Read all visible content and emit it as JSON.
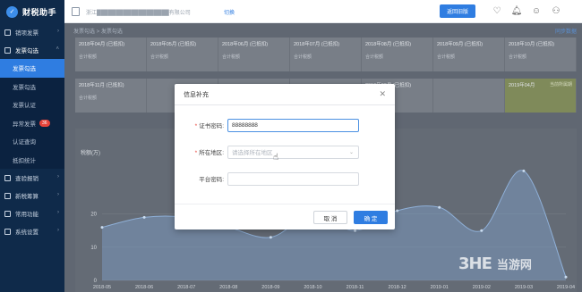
{
  "app": {
    "title": "财税助手",
    "company_name": "浙江███████████████████有限公司",
    "switch_label": "切换",
    "return_label": "返回旧版"
  },
  "top_icons": [
    "heart-icon",
    "bell-icon",
    "chat-icon",
    "user-icon"
  ],
  "sidebar": {
    "groups": [
      {
        "label": "销项发票",
        "open": false
      },
      {
        "label": "发票勾选",
        "open": true
      }
    ],
    "sub_items": [
      {
        "label": "发票勾选",
        "active": true
      },
      {
        "label": "发票勾选",
        "active": false
      },
      {
        "label": "发票认证",
        "active": false
      },
      {
        "label": "异常发票",
        "active": false,
        "badge": "36"
      },
      {
        "label": "认证查询",
        "active": false
      },
      {
        "label": "抵扣统计",
        "active": false
      }
    ],
    "more_groups": [
      {
        "label": "查验报销"
      },
      {
        "label": "新税筹算"
      },
      {
        "label": "常用功能"
      },
      {
        "label": "系统设置"
      }
    ]
  },
  "main": {
    "breadcrumb": "发票勾选 > 发票勾选",
    "sync_label": "同步数据",
    "months_row1": [
      "2018年04月 (已抵扣)",
      "2018年05月 (已抵扣)",
      "2018年06月 (已抵扣)",
      "2018年07月 (已抵扣)",
      "2018年08月 (已抵扣)",
      "2018年09月 (已抵扣)",
      "2018年10月 (已抵扣)"
    ],
    "months_row2": [
      "2018年11月 (已抵扣)",
      "",
      "",
      "",
      "2019年03月 (已抵扣)",
      "",
      "2019年04月"
    ],
    "month_sub": "合计税额",
    "highlight_side": "当前所属期",
    "chart_ylabel": "税额(万)"
  },
  "chart_data": {
    "type": "area",
    "categories": [
      "2018-05",
      "2018-06",
      "2018-07",
      "2018-08",
      "2018-09",
      "2018-10",
      "2018-11",
      "2018-12",
      "2019-01",
      "2019-02",
      "2019-03",
      "2019-04"
    ],
    "yticks": [
      "20",
      "10",
      "0"
    ],
    "ylim": [
      0,
      35
    ],
    "series": [
      {
        "values": [
          16,
          19,
          19,
          16,
          13,
          20,
          15,
          21,
          22,
          15,
          33,
          1
        ]
      }
    ],
    "ylabel": "税额(万)",
    "color": "#7ea2cc"
  },
  "dialog": {
    "title": "信息补充",
    "cert_label": "证书密码:",
    "cert_value": "88888888",
    "region_label": "所在地区:",
    "region_placeholder": "请选择所在地区",
    "platform_label": "平台密码:",
    "platform_value": "",
    "cancel_label": "取 消",
    "ok_label": "确 定"
  },
  "watermark": {
    "logo": "3HE",
    "text": "当游网"
  }
}
